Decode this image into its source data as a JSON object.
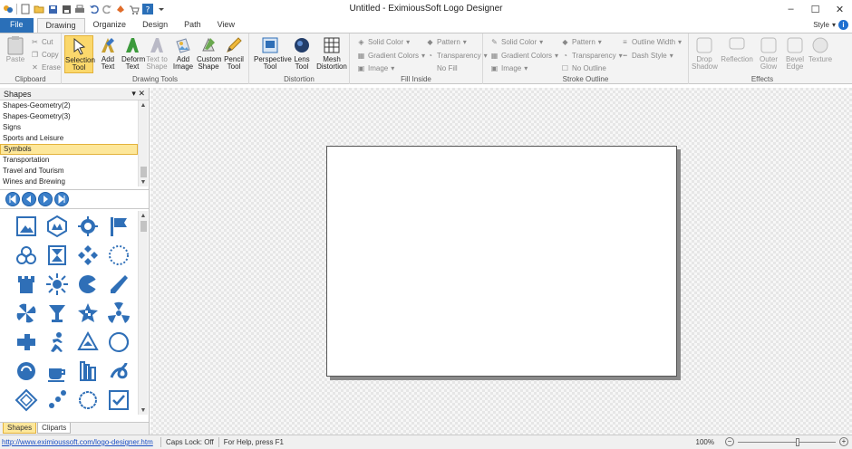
{
  "window": {
    "title": "Untitled - EximiousSoft Logo Designer",
    "minimize": "–",
    "maximize": "☐",
    "close": "✕"
  },
  "tabs": [
    "File",
    "Drawing",
    "Organize",
    "Design",
    "Path",
    "View"
  ],
  "active_tab": "Drawing",
  "style_menu": "Style",
  "ribbon": {
    "clipboard": {
      "label": "Clipboard",
      "paste": "Paste",
      "cut": "Cut",
      "copy": "Copy",
      "erase": "Erase"
    },
    "drawing_tools": {
      "label": "Drawing Tools",
      "selection_tool": "Selection Tool",
      "add_text": "Add Text",
      "deform_text": "Deform Text",
      "text_to_shape": "Text to Shape",
      "add_image": "Add Image",
      "custom_shape": "Custom Shape",
      "pencil_tool": "Pencil Tool"
    },
    "distortion": {
      "label": "Distortion",
      "perspective_tool": "Perspective Tool",
      "lens_tool": "Lens Tool",
      "mesh_distortion": "Mesh Distortion"
    },
    "fill_inside": {
      "label": "Fill Inside",
      "solid_color": "Solid Color",
      "pattern": "Pattern",
      "gradient_colors": "Gradient Colors",
      "transparency": "Transparency",
      "image": "Image",
      "no_fill": "No Fill"
    },
    "stroke_outline": {
      "label": "Stroke Outline",
      "solid_color": "Solid Color",
      "pattern": "Pattern",
      "outline_width": "Outline Width",
      "gradient_colors": "Gradient Colors",
      "transparency": "Transparency",
      "dash_style": "Dash Style",
      "image": "Image",
      "no_outline": "No Outline"
    },
    "effects": {
      "label": "Effects",
      "drop_shadow": "Drop Shadow",
      "reflection": "Reflection",
      "outer_glow": "Outer Glow",
      "bevel_edge": "Bevel Edge",
      "texture": "Texture"
    }
  },
  "shapes_panel": {
    "title": "Shapes",
    "categories": [
      "Shapes-Geometry(2)",
      "Shapes-Geometry(3)",
      "Signs",
      "Sports and Leisure",
      "Symbols",
      "Transportation",
      "Travel and Tourism",
      "Wines and Brewing"
    ],
    "selected_category": "Symbols",
    "tabs": [
      "Shapes",
      "Cliparts"
    ],
    "active_tab": "Shapes",
    "icon_color": "#2f6fb7"
  },
  "status": {
    "url": "http://www.eximioussoft.com/logo-designer.htm",
    "caps_lock": "Caps Lock: Off",
    "help": "For Help, press F1",
    "zoom": "100%",
    "zoom_level": 0.62
  },
  "colors": {
    "accent": "#2a6fb8",
    "selection": "#fbd86c",
    "icon_blue": "#2f6fb7"
  }
}
